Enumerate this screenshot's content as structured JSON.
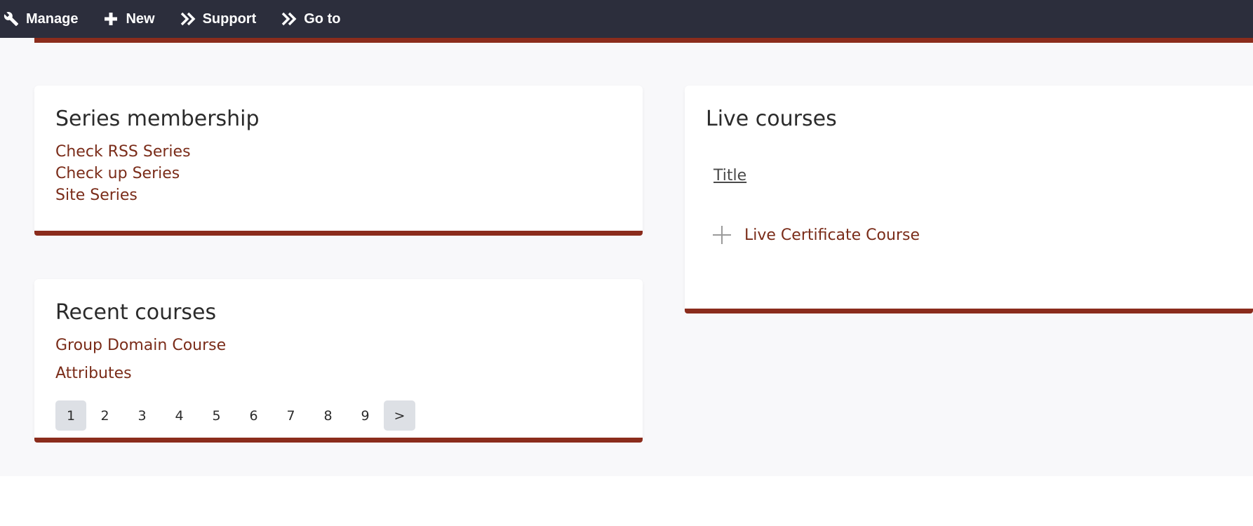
{
  "toolbar": {
    "items": [
      {
        "label": "Manage",
        "icon": "wrench-icon"
      },
      {
        "label": "New",
        "icon": "plus-icon"
      },
      {
        "label": "Support",
        "icon": "double-chevron-right-icon"
      },
      {
        "label": "Go to",
        "icon": "double-chevron-right-icon"
      }
    ]
  },
  "series_membership": {
    "title": "Series membership",
    "links": [
      "Check RSS Series",
      "Check up Series",
      "Site Series"
    ]
  },
  "recent_courses": {
    "title": "Recent courses",
    "links": [
      "Group Domain Course",
      "Attributes"
    ],
    "pager": {
      "current": "1",
      "pages": [
        "2",
        "3",
        "4",
        "5",
        "6",
        "7",
        "8",
        "9"
      ],
      "next_label": ">"
    }
  },
  "live_courses": {
    "title": "Live courses",
    "column_header": "Title",
    "rows": [
      {
        "title": "Live Certificate Course"
      }
    ]
  },
  "colors": {
    "toolbar_bg": "#2c2e3c",
    "accent": "#8b2c1c",
    "link": "#7a2c19",
    "page_bg": "#f8f8fa"
  }
}
